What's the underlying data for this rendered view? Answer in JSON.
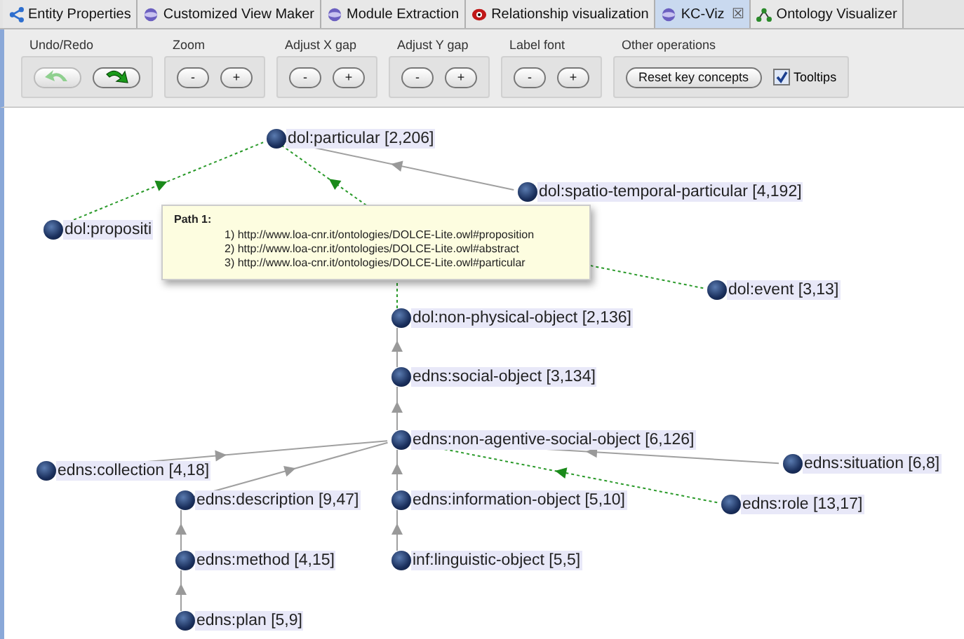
{
  "tabs": [
    {
      "label": "Entity Properties",
      "selected": false
    },
    {
      "label": "Customized View Maker",
      "selected": false
    },
    {
      "label": "Module Extraction",
      "selected": false
    },
    {
      "label": "Relationship visualization",
      "selected": false
    },
    {
      "label": "KC-Viz",
      "selected": true,
      "close": "☒"
    },
    {
      "label": "Ontology Visualizer",
      "selected": false
    }
  ],
  "toolbar": {
    "groups": [
      {
        "label": "Undo/Redo",
        "kind": "arrows",
        "buttons": [
          {
            "kind": "undo",
            "disabled": true
          },
          {
            "kind": "redo",
            "disabled": false
          }
        ]
      },
      {
        "label": "Zoom",
        "kind": "pm",
        "buttons": [
          {
            "text": "-"
          },
          {
            "text": "+"
          }
        ]
      },
      {
        "label": "Adjust X gap",
        "kind": "pm",
        "buttons": [
          {
            "text": "-"
          },
          {
            "text": "+"
          }
        ]
      },
      {
        "label": "Adjust Y gap",
        "kind": "pm",
        "buttons": [
          {
            "text": "-"
          },
          {
            "text": "+"
          }
        ]
      },
      {
        "label": "Label font",
        "kind": "pm",
        "buttons": [
          {
            "text": "-"
          },
          {
            "text": "+"
          }
        ]
      },
      {
        "label": "Other operations",
        "kind": "other",
        "button": "Reset key concepts",
        "checkbox": {
          "label": "Tooltips",
          "checked": true
        }
      }
    ]
  },
  "graph": {
    "nodes": [
      {
        "label": "dol:particular [2,206]"
      },
      {
        "label": "dol:spatio-temporal-particular [4,192]"
      },
      {
        "label": "dol:propositi"
      },
      {
        "label": "dol:event [3,13]"
      },
      {
        "label": "dol:non-physical-object [2,136]"
      },
      {
        "label": "edns:social-object [3,134]"
      },
      {
        "label": "edns:non-agentive-social-object [6,126]"
      },
      {
        "label": "edns:collection [4,18]"
      },
      {
        "label": "edns:situation [6,8]"
      },
      {
        "label": "edns:description [9,47]"
      },
      {
        "label": "edns:information-object [5,10]"
      },
      {
        "label": "edns:role [13,17]"
      },
      {
        "label": "edns:method [4,15]"
      },
      {
        "label": "inf:linguistic-object [5,5]"
      },
      {
        "label": "edns:plan [5,9]"
      }
    ],
    "tooltip": {
      "title": "Path 1:",
      "lines": [
        "1) http://www.loa-cnr.it/ontologies/DOLCE-Lite.owl#proposition",
        "2) http://www.loa-cnr.it/ontologies/DOLCE-Lite.owl#abstract",
        "3) http://www.loa-cnr.it/ontologies/DOLCE-Lite.owl#particular"
      ]
    }
  }
}
